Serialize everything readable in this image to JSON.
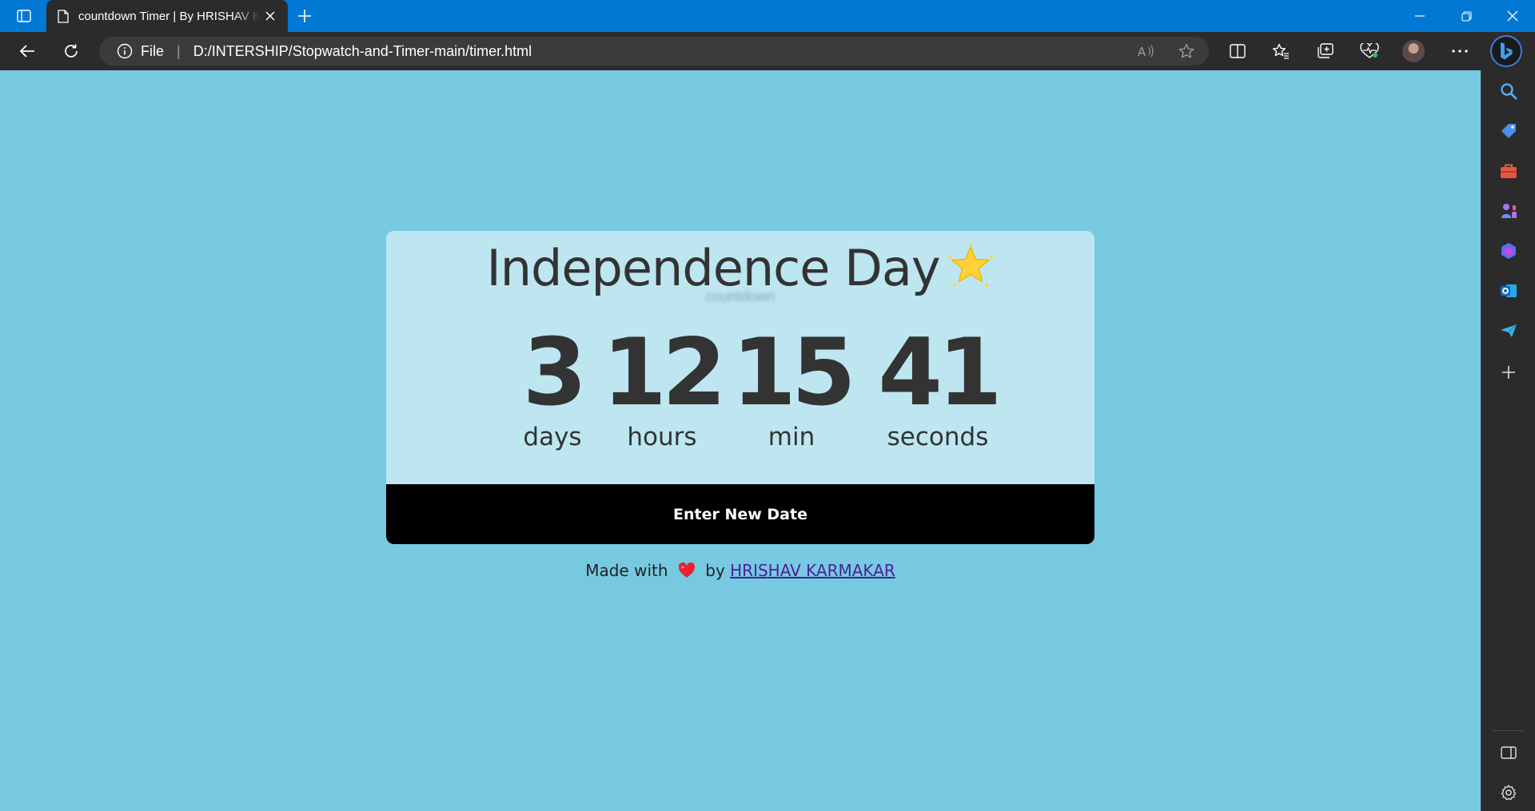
{
  "browser": {
    "tab_title": "countdown Timer | By HRISHAV KARMAKAR",
    "address": {
      "scheme_label": "File",
      "url": "D:/INTERSHIP/Stopwatch-and-Timer-main/timer.html"
    }
  },
  "page": {
    "event_title": "Independence Day",
    "subtitle": "countdown",
    "countdown": [
      {
        "value": "3",
        "label": "days"
      },
      {
        "value": "12",
        "label": "hours"
      },
      {
        "value": "15",
        "label": "min"
      },
      {
        "value": "41",
        "label": "seconds"
      }
    ],
    "enter_button": "Enter New Date",
    "footer": {
      "made_with": "Made with",
      "by": "by",
      "author": "HRISHAV KARMAKAR"
    }
  },
  "colors": {
    "page_background": "#76c9e1",
    "card_background": "#bde6f1",
    "button_background": "#000000",
    "titlebar": "#0078d4",
    "author_link": "#4b1f9a"
  },
  "icons": [
    "tab-actions-icon",
    "page-icon",
    "close-icon",
    "plus-icon",
    "minimize-icon",
    "restore-icon",
    "back-icon",
    "refresh-icon",
    "info-icon",
    "read-aloud-icon",
    "favorite-star-icon",
    "split-screen-icon",
    "favorites-icon",
    "collections-icon",
    "browser-essentials-icon",
    "more-icon",
    "bing-icon",
    "search-icon",
    "shopping-icon",
    "tools-icon",
    "games-icon",
    "copilot-icon",
    "outlook-icon",
    "send-icon",
    "add-icon",
    "sidebar-toggle-icon",
    "settings-icon",
    "star-emoji-icon",
    "heart-emoji-icon"
  ]
}
